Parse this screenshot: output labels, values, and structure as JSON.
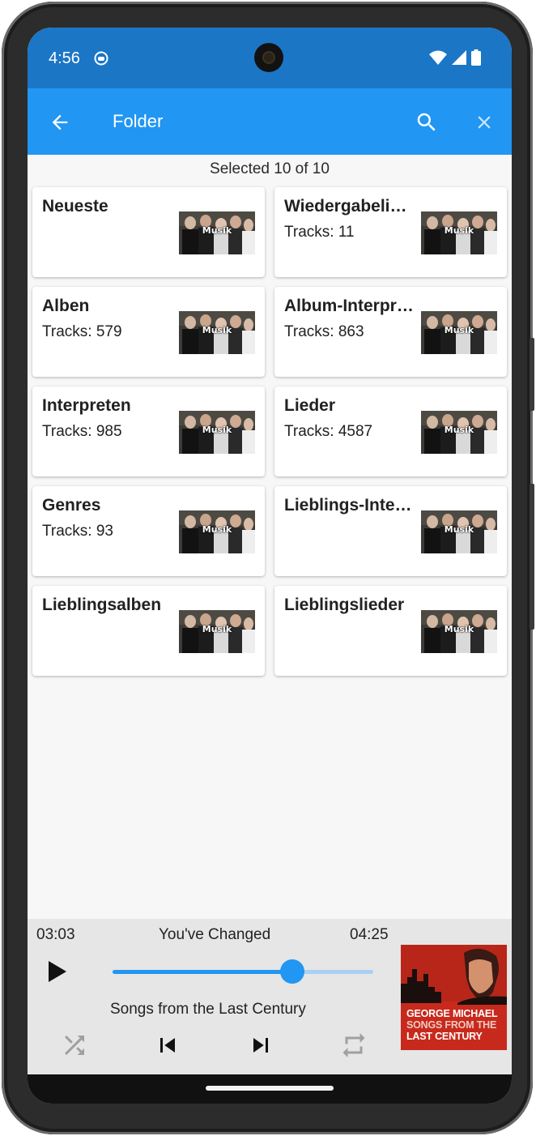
{
  "status_bar": {
    "time": "4:56"
  },
  "app_bar": {
    "title": "Folder"
  },
  "selection": {
    "text": "Selected 10 of 10"
  },
  "cards": [
    {
      "title": "Neueste",
      "tracks": "",
      "thumb_label": "Musik"
    },
    {
      "title": "Wiedergabelisten",
      "tracks": "Tracks: 11",
      "thumb_label": "Musik"
    },
    {
      "title": "Alben",
      "tracks": "Tracks: 579",
      "thumb_label": "Musik"
    },
    {
      "title": "Album-Interpreten",
      "tracks": "Tracks: 863",
      "thumb_label": "Musik"
    },
    {
      "title": "Interpreten",
      "tracks": "Tracks: 985",
      "thumb_label": "Musik"
    },
    {
      "title": "Lieder",
      "tracks": "Tracks: 4587",
      "thumb_label": "Musik"
    },
    {
      "title": "Genres",
      "tracks": "Tracks: 93",
      "thumb_label": "Musik"
    },
    {
      "title": "Lieblings-Interpreten",
      "tracks": "",
      "thumb_label": "Musik"
    },
    {
      "title": "Lieblingsalben",
      "tracks": "",
      "thumb_label": "Musik"
    },
    {
      "title": "Lieblingslieder",
      "tracks": "",
      "thumb_label": "Musik"
    }
  ],
  "player": {
    "elapsed": "03:03",
    "title": "You've Changed",
    "duration": "04:25",
    "album": "Songs from the Last Century",
    "progress_fraction": 0.69,
    "cover": {
      "line1": "GEORGE MICHAEL",
      "line2": "SONGS FROM THE",
      "line3": "LAST CENTURY"
    }
  },
  "colors": {
    "status_bar": "#1b76c6",
    "app_bar": "#2196f3",
    "accent": "#2196f3",
    "cover_red": "#c72a1c"
  }
}
